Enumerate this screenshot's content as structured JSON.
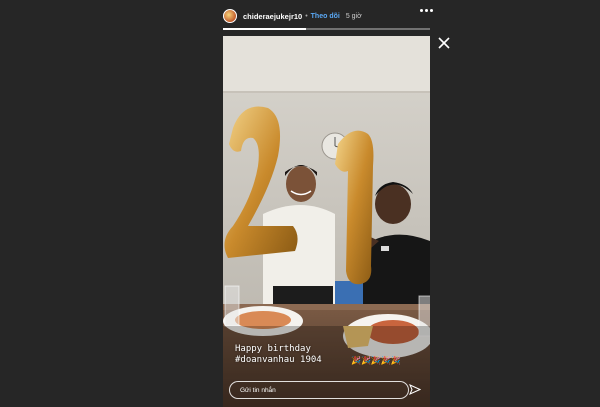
{
  "header": {
    "username": "chideraejukejr10",
    "separator": "•",
    "follow_label": "Theo dõi",
    "time": "5 giờ"
  },
  "story": {
    "progress_fraction": 0.4,
    "balloons": "21",
    "caption_line1": "Happy birthday",
    "caption_line2": "#doanvanhau 1904",
    "emojis": "🎉🎉🎉🎉🎉"
  },
  "reply": {
    "placeholder": "Gửi tin nhắn"
  },
  "icons": {
    "more": "more-horizontal-icon",
    "close": "close-icon",
    "send": "send-icon"
  }
}
